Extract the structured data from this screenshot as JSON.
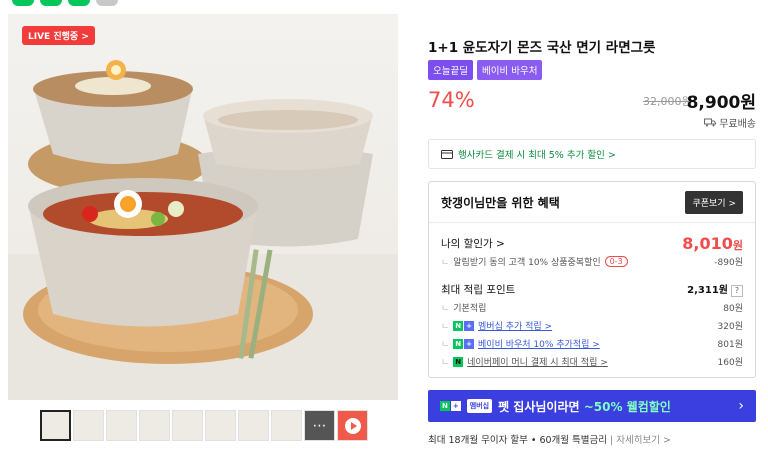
{
  "live_badge": {
    "live": "LIVE",
    "status": "진행중 >"
  },
  "product": {
    "title": "1+1 윤도자기 몬즈 국산 면기 라면그릇",
    "tags": [
      "오늘끝딜",
      "베이비 바우처"
    ],
    "discount": "74%",
    "original_price": "32,000원",
    "price": "8,900원",
    "shipping": "무료배송"
  },
  "card_banner": "행사카드 결제 시 최대 5% 추가 할인 >",
  "benefit": {
    "heading": "핫갱이님만을 위한 혜택",
    "coupon_button": "쿠폰보기 >",
    "my_price_label": "나의 할인가 >",
    "my_price_value": "8,010",
    "my_price_unit": "원",
    "alarm_text": "알림받기 동의 고객 10% 상품중복할인",
    "alarm_badge": "0-3",
    "alarm_value": "-890원",
    "points_label": "최대 적립 포인트",
    "points_value": "2,311원",
    "points_help": "?",
    "rows": [
      {
        "label": "기본적립",
        "value": "80원"
      },
      {
        "label": "멤버십 추가 적립 >",
        "value": "320원"
      },
      {
        "label": "베이비 바우처 10% 추가적립 >",
        "value": "801원"
      },
      {
        "label": "네이버페이 머니 결제 시 최대 적립 >",
        "value": "160원"
      }
    ]
  },
  "nplus_banner": {
    "badge": "멤버십",
    "text_pre": "펫 집사님이라면 ",
    "text_hl": "~50% 웰컴할인",
    "arrow": "›"
  },
  "install": {
    "text": "최대 18개월 무이자 할부 • 60개월 특별금리",
    "link": "자세히보기 >"
  },
  "colors": {
    "discount": "#f24b4b",
    "naver_green": "#03c75a",
    "banner_blue": "#3b3fe0",
    "tag_purple": "#7c4ef0"
  }
}
